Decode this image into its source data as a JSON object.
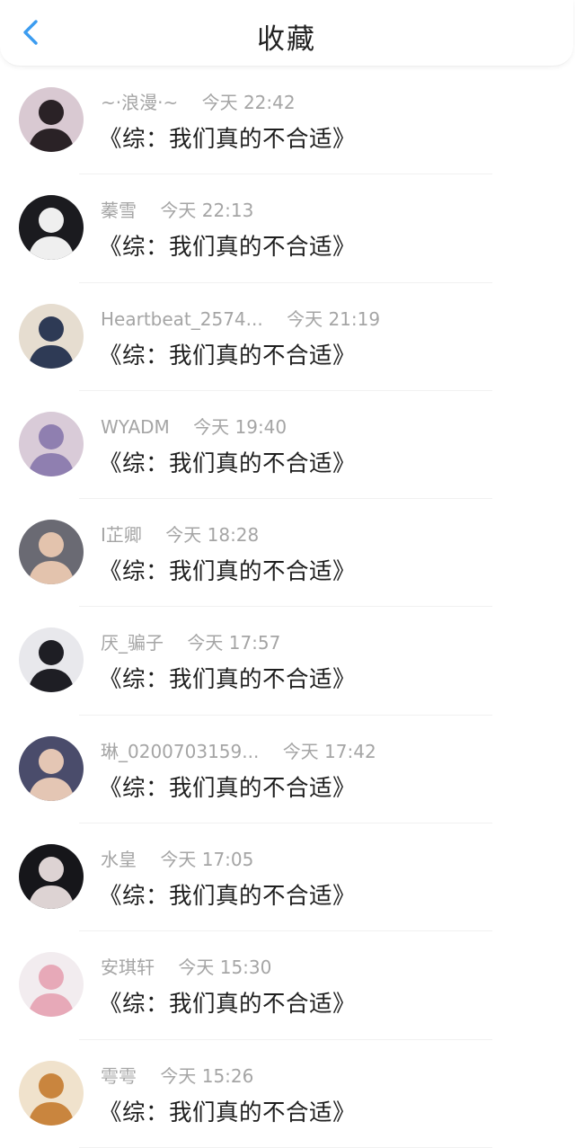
{
  "header": {
    "title": "收藏",
    "back_icon": "chevron-left-icon",
    "accent_color": "#3b9cf0"
  },
  "items": [
    {
      "name": "~·浪漫·~",
      "time": "今天 22:42",
      "message": "《综：我们真的不合适》",
      "avatar_bg": "#d9c9d2",
      "avatar_fg": "#2a2226"
    },
    {
      "name": "蓁雪",
      "time": "今天 22:13",
      "message": "《综：我们真的不合适》",
      "avatar_bg": "#1b1b1f",
      "avatar_fg": "#efefef"
    },
    {
      "name": "Heartbeat_2574...",
      "time": "今天 21:19",
      "message": "《综：我们真的不合适》",
      "avatar_bg": "#e6ddd0",
      "avatar_fg": "#2e3a55"
    },
    {
      "name": "WYADM",
      "time": "今天 19:40",
      "message": "《综：我们真的不合适》",
      "avatar_bg": "#d9cbd8",
      "avatar_fg": "#8f7fb0"
    },
    {
      "name": "I芷卿",
      "time": "今天 18:28",
      "message": "《综：我们真的不合适》",
      "avatar_bg": "#6a6a73",
      "avatar_fg": "#e3c3ad"
    },
    {
      "name": "厌_骗子",
      "time": "今天 17:57",
      "message": "《综：我们真的不合适》",
      "avatar_bg": "#e8e8ec",
      "avatar_fg": "#1e1e24"
    },
    {
      "name": "琳_0200703159...",
      "time": "今天 17:42",
      "message": "《综：我们真的不合适》",
      "avatar_bg": "#4a4c6b",
      "avatar_fg": "#e4c6b4"
    },
    {
      "name": "水皇",
      "time": "今天 17:05",
      "message": "《综：我们真的不合适》",
      "avatar_bg": "#16161a",
      "avatar_fg": "#ddd3d3"
    },
    {
      "name": "安琪轩",
      "time": "今天 15:30",
      "message": "《综：我们真的不合适》",
      "avatar_bg": "#f2ecef",
      "avatar_fg": "#e7a9b8"
    },
    {
      "name": "雩雩",
      "time": "今天 15:26",
      "message": "《综：我们真的不合适》",
      "avatar_bg": "#f0e2cc",
      "avatar_fg": "#c9853e"
    }
  ]
}
